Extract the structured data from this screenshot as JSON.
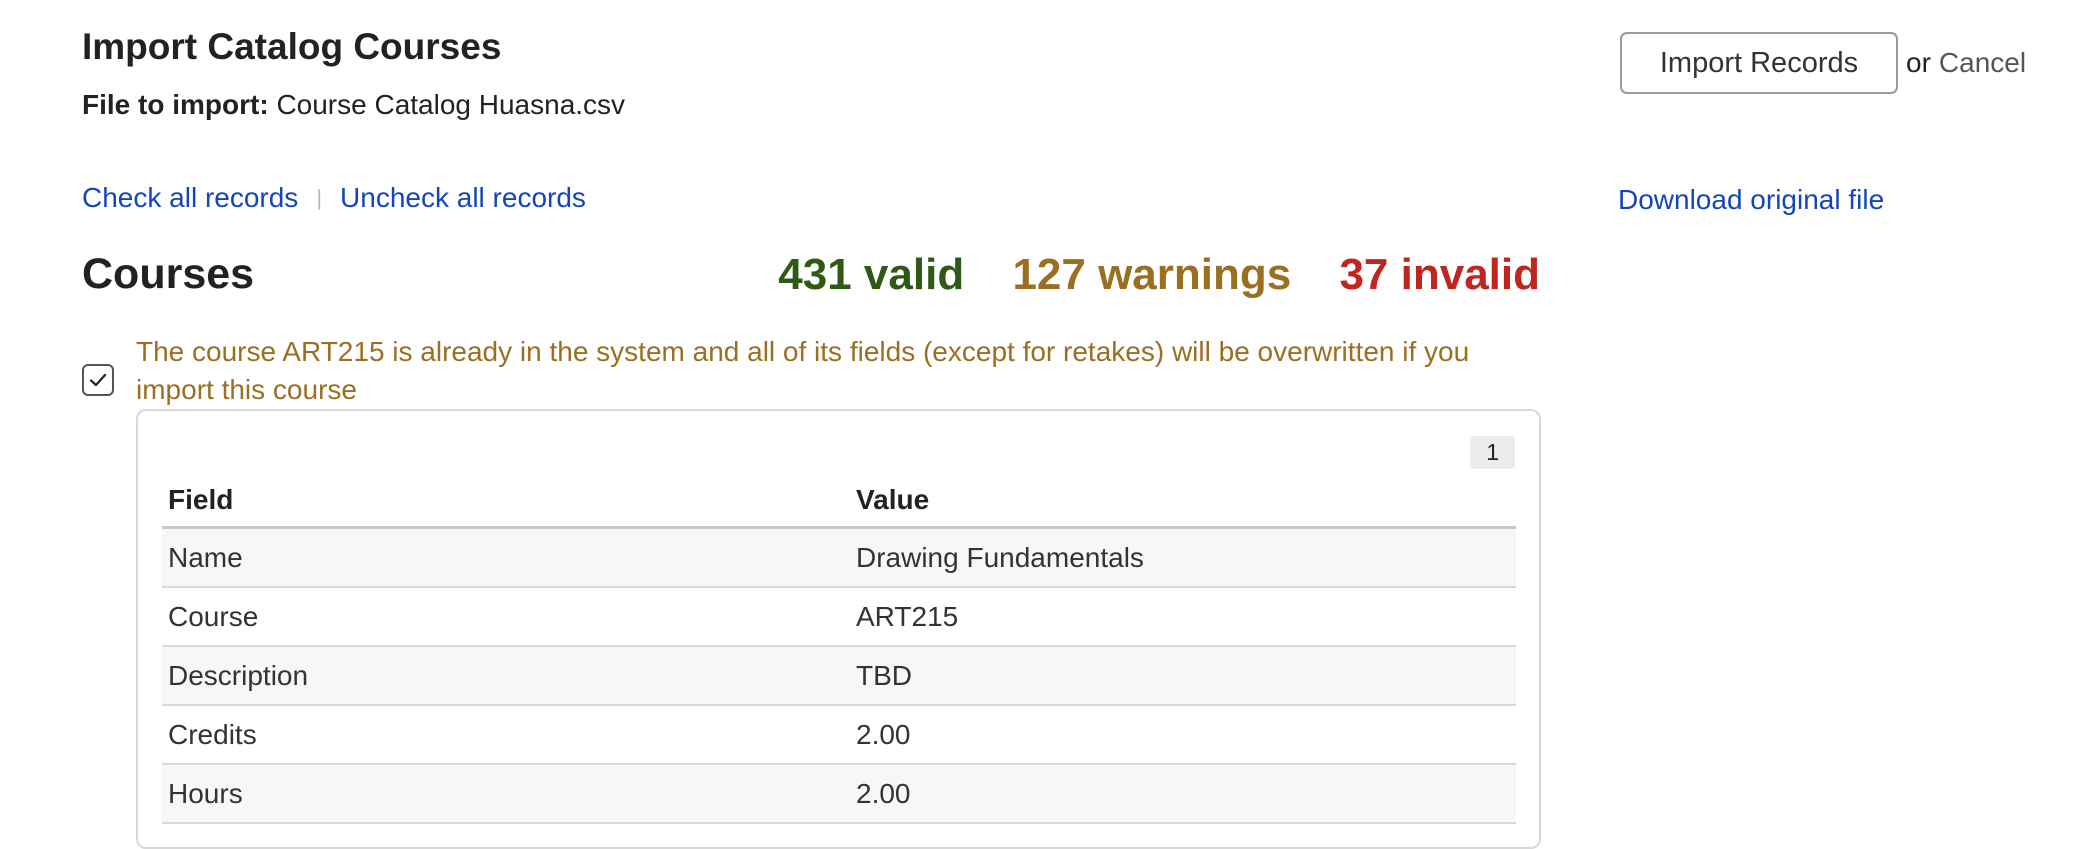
{
  "header": {
    "title": "Import Catalog Courses",
    "file_label": "File to import:",
    "file_name": "Course Catalog Huasna.csv"
  },
  "actions": {
    "import_label": "Import Records",
    "or_text": "or",
    "cancel_label": "Cancel"
  },
  "selection": {
    "check_all": "Check all records",
    "separator": "|",
    "uncheck_all": "Uncheck all records"
  },
  "download": {
    "label": "Download original file"
  },
  "section": {
    "title": "Courses",
    "valid": "431 valid",
    "warnings": "127 warnings",
    "invalid": "37 invalid"
  },
  "record": {
    "checked": true,
    "message": "The course ART215 is already in the system and all of its fields (except for retakes) will be overwritten if you import this course",
    "number": "1",
    "columns": [
      "Field",
      "Value"
    ],
    "rows": [
      [
        "Name",
        "Drawing Fundamentals"
      ],
      [
        "Course",
        "ART215"
      ],
      [
        "Description",
        "TBD"
      ],
      [
        "Credits",
        "2.00"
      ],
      [
        "Hours",
        "2.00"
      ]
    ]
  },
  "colors": {
    "valid": "#2f5a16",
    "warning": "#9b6f22",
    "invalid": "#c0261f",
    "link": "#1446b8"
  },
  "icons": {
    "checkbox": "checkmark-icon"
  }
}
